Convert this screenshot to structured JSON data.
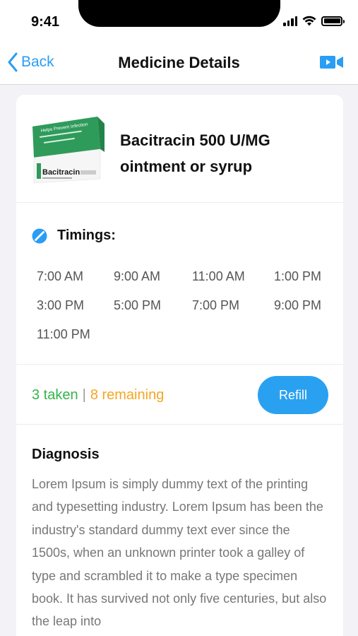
{
  "status_bar": {
    "time": "9:41"
  },
  "nav": {
    "back_label": "Back",
    "title": "Medicine Details"
  },
  "medicine": {
    "name": "Bacitracin 500 U/MG ointment or syrup",
    "box_headline": "Helps Prevent Infection",
    "box_brand": "Bacitracin"
  },
  "timings": {
    "title": "Timings:",
    "times": [
      "7:00 AM",
      "9:00 AM",
      "11:00 AM",
      "1:00 PM",
      "3:00 PM",
      "5:00 PM",
      "7:00 PM",
      "9:00 PM",
      "11:00 PM"
    ]
  },
  "progress": {
    "taken_label": "3 taken",
    "separator": "|",
    "remaining_label": "8 remaining"
  },
  "refill_label": "Refill",
  "diagnosis": {
    "title": "Diagnosis",
    "text": "Lorem Ipsum is simply dummy text of the printing and typesetting industry. Lorem Ipsum has been the industry's standard dummy text ever since the 1500s, when an unknown printer took a galley of type and scrambled it to make a type specimen book. It has survived not only five centuries, but also the leap into"
  },
  "colors": {
    "accent": "#2aa1f0",
    "taken": "#34b44a",
    "remaining": "#f5a623",
    "box_green": "#2e9b5a"
  },
  "icons": [
    "back-chevron-icon",
    "video-camera-icon",
    "pill-icon",
    "wifi-icon",
    "signal-icon",
    "battery-icon"
  ]
}
